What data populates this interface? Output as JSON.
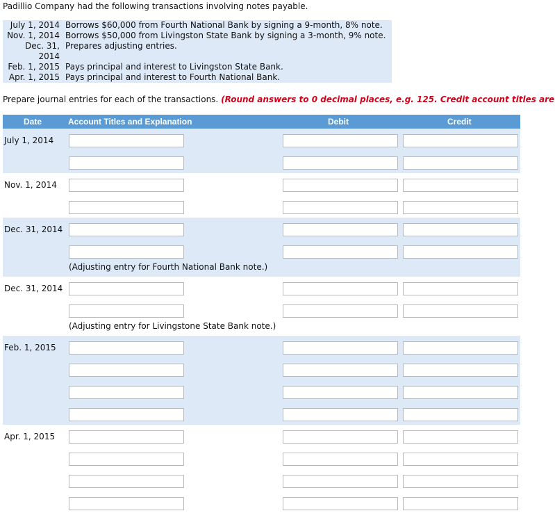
{
  "intro": "Padillio Company had the following transactions involving notes payable.",
  "transactions": [
    {
      "date": "July 1, 2014",
      "desc": "Borrows $60,000 from Fourth National Bank by signing a 9-month, 8% note."
    },
    {
      "date": "Nov. 1, 2014",
      "desc": "Borrows $50,000 from Livingston State Bank by signing a 3-month, 9% note."
    },
    {
      "date": "Dec. 31,",
      "desc": "Prepares adjusting entries."
    },
    {
      "date": "2014",
      "desc": ""
    },
    {
      "date": "Feb. 1, 2015",
      "desc": "Pays principal and interest to Livingston State Bank."
    },
    {
      "date": "Apr. 1, 2015",
      "desc": "Pays principal and interest to Fourth National Bank."
    }
  ],
  "instructions": {
    "text": "Prepare journal entries for each of the transactions.",
    "red": "(Round answers to 0 decimal places, e.g. 125. Credit account titles are"
  },
  "table": {
    "headers": {
      "date": "Date",
      "account": "Account Titles and Explanation",
      "debit": "Debit",
      "credit": "Credit"
    },
    "groups": [
      {
        "date": "July 1, 2014",
        "lines": 2,
        "note": "",
        "shaded": true
      },
      {
        "date": "Nov. 1, 2014",
        "lines": 2,
        "note": "",
        "shaded": false
      },
      {
        "date": "Dec. 31, 2014",
        "lines": 2,
        "note": "(Adjusting entry for Fourth National Bank note.)",
        "shaded": true
      },
      {
        "date": "Dec. 31, 2014",
        "lines": 2,
        "note": "(Adjusting entry for Livingstone State Bank note.)",
        "shaded": false
      },
      {
        "date": "Feb. 1, 2015",
        "lines": 4,
        "note": "",
        "shaded": true
      },
      {
        "date": "Apr. 1, 2015",
        "lines": 4,
        "note": "",
        "shaded": false
      }
    ]
  }
}
